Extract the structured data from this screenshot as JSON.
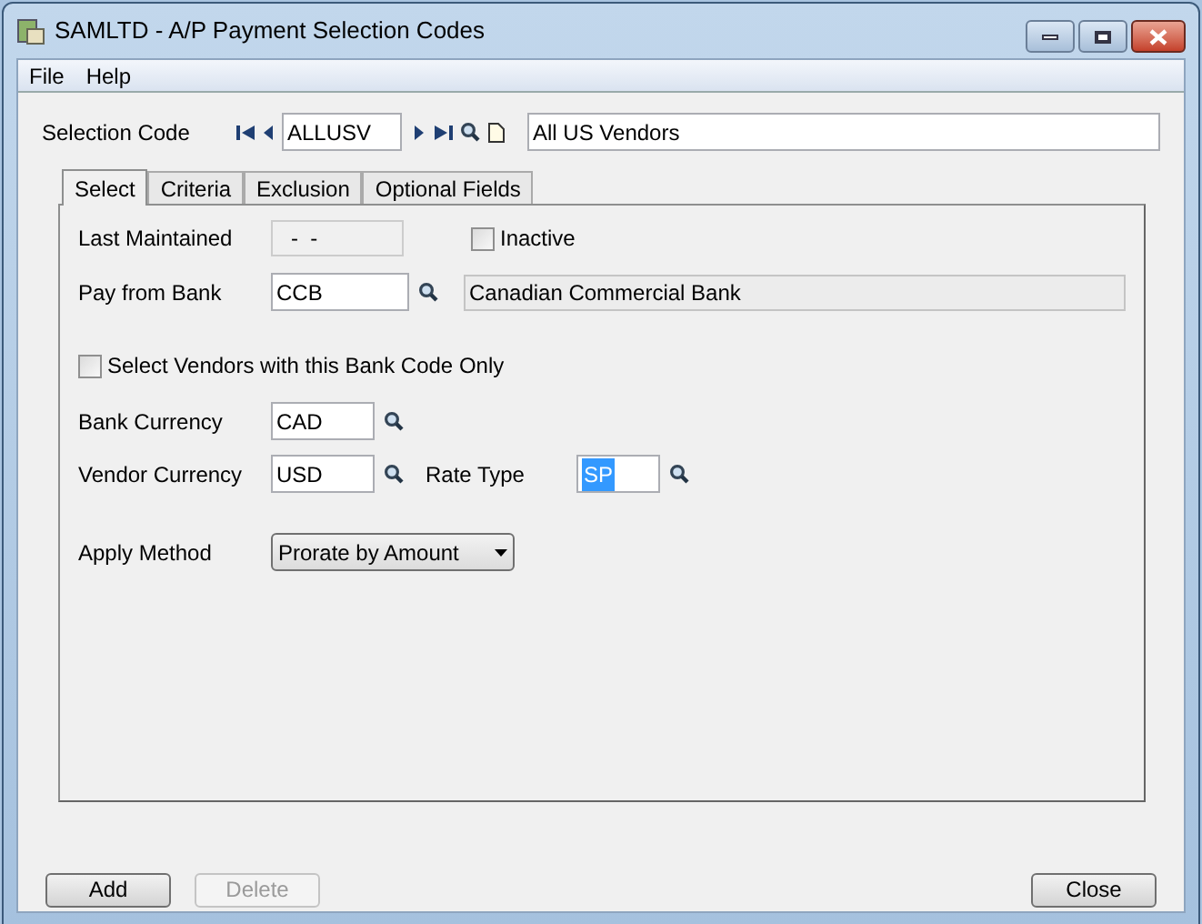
{
  "window": {
    "title": "SAMLTD - A/P Payment Selection Codes"
  },
  "menu": [
    "File",
    "Help"
  ],
  "selection_code": {
    "label": "Selection Code",
    "value": "ALLUSV",
    "description": "All US Vendors"
  },
  "tabs": [
    {
      "label": "Select",
      "selected": true
    },
    {
      "label": "Criteria",
      "selected": false
    },
    {
      "label": "Exclusion",
      "selected": false
    },
    {
      "label": "Optional Fields",
      "selected": false
    }
  ],
  "last_maintained": {
    "label": "Last Maintained",
    "value": "-  -"
  },
  "inactive": {
    "label": "Inactive",
    "checked": false
  },
  "pay_from_bank": {
    "label": "Pay from Bank",
    "value": "CCB",
    "description": "Canadian Commercial Bank"
  },
  "bank_code_only": {
    "label": "Select Vendors with this Bank Code Only",
    "checked": false
  },
  "bank_currency": {
    "label": "Bank Currency",
    "value": "CAD"
  },
  "vendor_currency": {
    "label": "Vendor Currency",
    "value": "USD"
  },
  "rate_type": {
    "label": "Rate Type",
    "value": "SP",
    "selected": true
  },
  "apply_method": {
    "label": "Apply Method",
    "value": "Prorate by Amount"
  },
  "buttons": [
    {
      "label": "Add",
      "disabled": false
    },
    {
      "label": "Delete",
      "disabled": true
    },
    {
      "label": "Close",
      "disabled": false
    }
  ]
}
